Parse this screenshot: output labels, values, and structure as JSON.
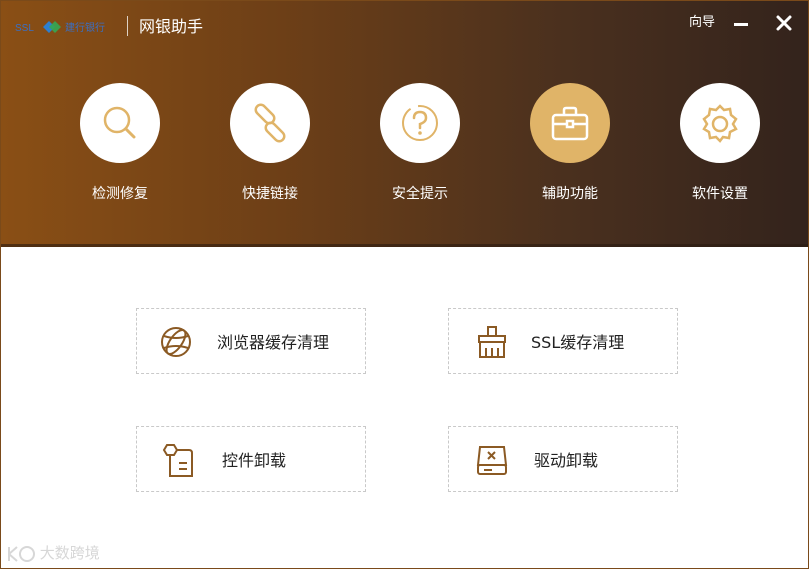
{
  "titlebar": {
    "logo_alt": "SSL",
    "logo_text": "建行银行",
    "app_title": "网银助手",
    "guide_label": "向导"
  },
  "nav": [
    {
      "label": "检测修复",
      "icon": "search-icon"
    },
    {
      "label": "快捷链接",
      "icon": "link-icon"
    },
    {
      "label": "安全提示",
      "icon": "question-icon"
    },
    {
      "label": "辅助功能",
      "icon": "toolbox-icon",
      "active": true
    },
    {
      "label": "软件设置",
      "icon": "gear-icon"
    }
  ],
  "tools": [
    {
      "label": "浏览器缓存清理",
      "icon": "globe-icon"
    },
    {
      "label": "SSL缓存清理",
      "icon": "broom-icon"
    },
    {
      "label": "控件卸载",
      "icon": "component-icon"
    },
    {
      "label": "驱动卸载",
      "icon": "drive-icon"
    }
  ],
  "watermark": "大数跨境",
  "colors": {
    "header_start": "#8a4f15",
    "header_end": "#33231c",
    "accent": "#e0b468",
    "icon_brown": "#8b5a24"
  }
}
